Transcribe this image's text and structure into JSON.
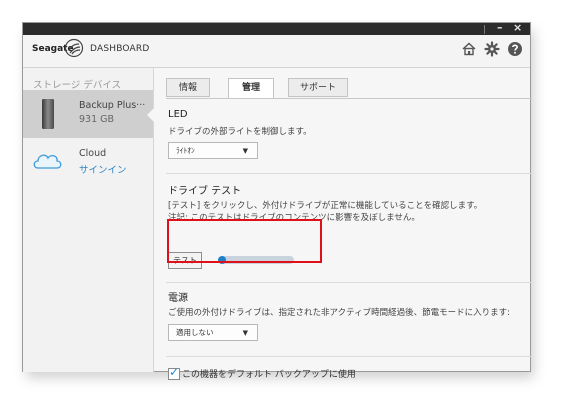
{
  "window": {
    "controls": {
      "minimize": "–",
      "close": "×"
    },
    "brand": "Seagate",
    "app_title": "DASHBOARD",
    "header_icons": [
      "home-icon",
      "gear-icon",
      "help-icon"
    ]
  },
  "sidebar": {
    "heading": "ストレージ デバイス",
    "items": [
      {
        "title": "Backup Plus···",
        "subtitle": "931 GB",
        "icon": "external-drive-icon",
        "selected": true
      },
      {
        "title": "Cloud",
        "subtitle": "サインイン",
        "icon": "cloud-icon",
        "selected": false
      }
    ]
  },
  "tabs": [
    {
      "label": "情報",
      "active": false
    },
    {
      "label": "管理",
      "active": true
    },
    {
      "label": "サポート",
      "active": false
    }
  ],
  "sections": {
    "led": {
      "title": "LED",
      "desc": "ドライブの外部ライトを制御します。",
      "dropdown_value": "ﾗｲﾄｵﾝ"
    },
    "drive_test": {
      "title": "ドライブ テスト",
      "desc1": "[テスト] をクリックし、外付けドライブが正常に機能していることを確認します。",
      "desc2": "注記: このテストはドライブのコンテンツに影響を及ぼしません。",
      "button_label": "テスト",
      "progress_fraction": 0.1
    },
    "power": {
      "title": "電源",
      "desc": "ご使用の外付けドライブは、指定された非アクティブ時間経過後、節電モードに入ります:",
      "dropdown_value": "適用しない"
    },
    "default_backup": {
      "checked": true,
      "label": "この機器をデフォルト バックアップに使用"
    }
  },
  "colors": {
    "accent": "#1e7fc8",
    "highlight": "#e0101a",
    "link": "#2c87c7"
  }
}
